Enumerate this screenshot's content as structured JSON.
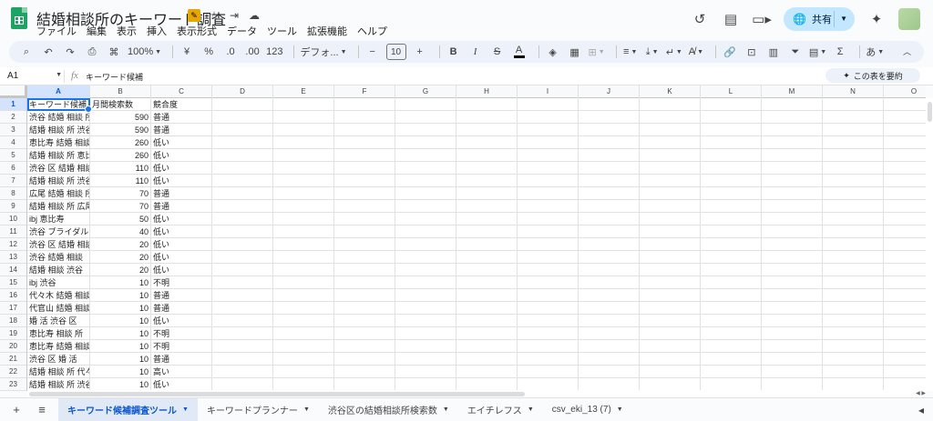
{
  "document": {
    "title": "結婚相談所のキーワード調査",
    "menu": [
      "ファイル",
      "編集",
      "表示",
      "挿入",
      "表示形式",
      "データ",
      "ツール",
      "拡張機能",
      "ヘルプ"
    ]
  },
  "header": {
    "share_label": "共有",
    "icons": [
      "history-icon",
      "comment-icon",
      "video-call-icon",
      "gemini-sparkle-icon"
    ]
  },
  "toolbar": {
    "zoom": "100%",
    "percent": "%",
    "decimal_decrease": ".0",
    "decimal_increase": ".00",
    "number_format": "123",
    "font": "デフォ...",
    "font_size": "10",
    "bold": "B",
    "italic": "I",
    "text_color": "A",
    "input_tool": "あ"
  },
  "formula_bar": {
    "cell_ref": "A1",
    "fx": "fx",
    "content": "キーワード候補",
    "summary_button": "この表を要約"
  },
  "columns": [
    "A",
    "B",
    "C",
    "D",
    "E",
    "F",
    "G",
    "H",
    "I",
    "J",
    "K",
    "L",
    "M",
    "N",
    "O"
  ],
  "rows": [
    [
      "キーワード候補",
      "月間検索数",
      "競合度"
    ],
    [
      "渋谷 結婚 相談 所",
      "590",
      "普通"
    ],
    [
      "結婚 相談 所 渋谷",
      "590",
      "普通"
    ],
    [
      "恵比寿 結婚 相談 所",
      "260",
      "低い"
    ],
    [
      "結婚 相談 所 恵比寿",
      "260",
      "低い"
    ],
    [
      "渋谷 区 結婚 相談 所",
      "110",
      "低い"
    ],
    [
      "結婚 相談 所 渋谷 区",
      "110",
      "低い"
    ],
    [
      "広尾 結婚 相談 所",
      "70",
      "普通"
    ],
    [
      "結婚 相談 所 広尾",
      "70",
      "普通"
    ],
    [
      "ibj 恵比寿",
      "50",
      "低い"
    ],
    [
      "渋谷 ブライダル",
      "40",
      "低い"
    ],
    [
      "渋谷 区 結婚 相談",
      "20",
      "低い"
    ],
    [
      "渋谷 結婚 相談",
      "20",
      "低い"
    ],
    [
      "結婚 相談 渋谷",
      "20",
      "低い"
    ],
    [
      "ibj 渋谷",
      "10",
      "不明"
    ],
    [
      "代々木 結婚 相談 所",
      "10",
      "普通"
    ],
    [
      "代官山 結婚 相談 所",
      "10",
      "普通"
    ],
    [
      "婚 活 渋谷 区",
      "10",
      "低い"
    ],
    [
      "恵比寿 相談 所",
      "10",
      "不明"
    ],
    [
      "恵比寿 結婚 相談",
      "10",
      "不明"
    ],
    [
      "渋谷 区 婚 活",
      "10",
      "普通"
    ],
    [
      "結婚 相談 所 代々木",
      "10",
      "高い"
    ],
    [
      "結婚 相談 所 渋谷 駅",
      "10",
      "低い"
    ]
  ],
  "sheet_tabs": [
    {
      "label": "キーワード候補調査ツール",
      "active": true
    },
    {
      "label": "キーワードプランナー",
      "active": false
    },
    {
      "label": "渋谷区の結婚相談所検索数",
      "active": false
    },
    {
      "label": "エイチレフス",
      "active": false
    },
    {
      "label": "csv_eki_13 (7)",
      "active": false
    }
  ],
  "colors": {
    "accent": "#0b57d0",
    "share_bg": "#c2e7ff",
    "sheets_green": "#1ea362",
    "selection": "#1a73e8"
  }
}
